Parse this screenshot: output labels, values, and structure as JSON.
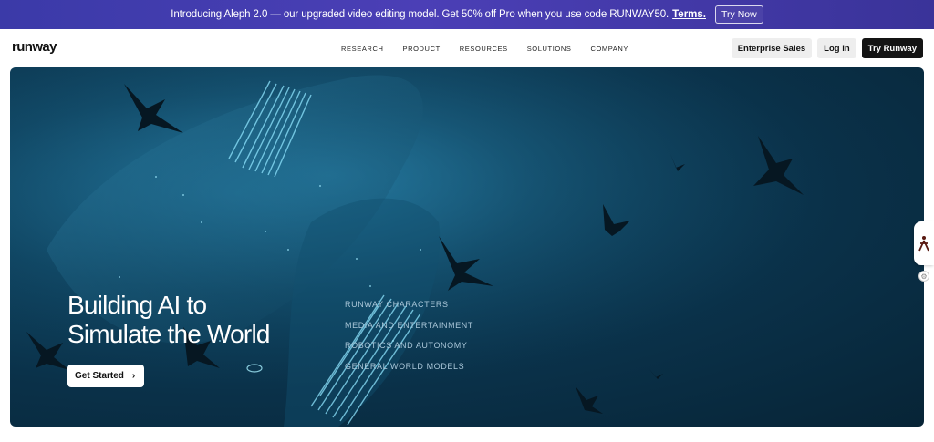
{
  "announcement": {
    "message": "Introducing Aleph 2.0 — our upgraded video editing model. Get 50% off Pro when you use code RUNWAY50.",
    "terms_label": "Terms.",
    "cta_label": "Try Now"
  },
  "nav": {
    "logo": "runway",
    "menu": [
      "RESEARCH",
      "PRODUCT",
      "RESOURCES",
      "SOLUTIONS",
      "COMPANY"
    ],
    "enterprise_label": "Enterprise Sales",
    "login_label": "Log in",
    "try_label": "Try Runway"
  },
  "hero": {
    "headline_line1": "Building AI to",
    "headline_line2": "Simulate the World",
    "cta_label": "Get Started",
    "links": [
      "RUNWAY CHARACTERS",
      "MEDIA AND ENTERTAINMENT",
      "ROBOTICS AND AUTONOMY",
      "GENERAL WORLD MODELS"
    ]
  },
  "colors": {
    "announcement_bg": "#4b3fb6",
    "hero_bg": "#0a3149",
    "dark_button": "#141414"
  },
  "icons": [
    "chevron-right-icon",
    "accessibility-person-icon",
    "gear-icon"
  ]
}
